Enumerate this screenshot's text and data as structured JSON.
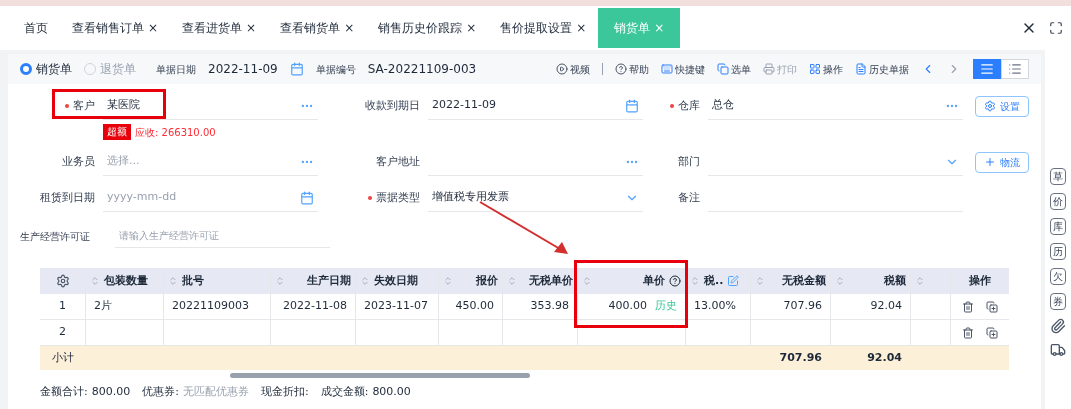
{
  "tabs": [
    {
      "label": "首页",
      "closable": false,
      "selected": false
    },
    {
      "label": "查看销售订单",
      "closable": true,
      "selected": false
    },
    {
      "label": "查看进货单",
      "closable": true,
      "selected": false
    },
    {
      "label": "查看销货单",
      "closable": true,
      "selected": false
    },
    {
      "label": "销售历史价跟踪",
      "closable": true,
      "selected": false
    },
    {
      "label": "售价提取设置",
      "closable": true,
      "selected": false
    },
    {
      "label": "销货单",
      "closable": true,
      "selected": true
    }
  ],
  "close_glyph": "×",
  "bill_types": [
    {
      "label": "销货单",
      "selected": true
    },
    {
      "label": "退货单",
      "selected": false
    }
  ],
  "bill_date": {
    "label": "单据日期",
    "value": "2022-11-09"
  },
  "bill_no": {
    "label": "单据编号",
    "value": "SA-20221109-003"
  },
  "toolbar": [
    {
      "kind": "video",
      "label": "视频",
      "disabled": false
    },
    {
      "kind": "help",
      "label": "帮助",
      "disabled": false
    },
    {
      "kind": "shortcut",
      "label": "快捷键",
      "disabled": false
    },
    {
      "kind": "pick",
      "label": "选单",
      "disabled": false
    },
    {
      "kind": "print",
      "label": "打印",
      "disabled": true
    },
    {
      "kind": "ops",
      "label": "操作",
      "disabled": false
    },
    {
      "kind": "history",
      "label": "历史单据",
      "disabled": false
    }
  ],
  "views": [
    {
      "kind": "list",
      "selected": true
    },
    {
      "kind": "detail",
      "selected": false
    }
  ],
  "form": [
    [
      {
        "label": "客户",
        "required": true,
        "value": "某医院",
        "kind": "more"
      },
      {
        "label": "收款到期日",
        "required": false,
        "value": "2022-11-09",
        "kind": "date"
      },
      {
        "label": "仓库",
        "required": true,
        "value": "总仓",
        "kind": "more"
      }
    ],
    [
      {
        "label": "业务员",
        "required": false,
        "placeholder": "选择...",
        "kind": "more"
      },
      {
        "label": "客户地址",
        "required": false,
        "kind": "more"
      },
      {
        "label": "部门",
        "required": false,
        "kind": "select"
      }
    ],
    [
      {
        "label": "租赁到日期",
        "required": false,
        "placeholder": "yyyy-mm-dd",
        "kind": "date"
      },
      {
        "label": "票据类型",
        "required": true,
        "value": "增值税专用发票",
        "kind": "select"
      },
      {
        "label": "备注",
        "required": false,
        "kind": "text"
      }
    ]
  ],
  "credit": {
    "badge": "超额",
    "text": "应收: 266310.00"
  },
  "side_buttons": [
    {
      "kind": "settings",
      "label": "设置"
    },
    {
      "kind": "add",
      "label": "物流"
    }
  ],
  "license": {
    "label": "生产经营许可证",
    "placeholder": "请输入生产经营许可证"
  },
  "table": {
    "columns": [
      {
        "label": "包装数量"
      },
      {
        "label": "批号"
      },
      {
        "label": "生产日期"
      },
      {
        "label": "失效日期"
      },
      {
        "label": "报价"
      },
      {
        "label": "无税单价"
      },
      {
        "label": "单价"
      },
      {
        "label": "税.."
      },
      {
        "label": "无税金额"
      },
      {
        "label": "税额"
      },
      {}
    ],
    "ops_label": "操作",
    "rows": [
      {
        "index": "1",
        "cells": [
          "2片",
          "20221109003",
          "2022-11-08",
          "2023-11-07",
          "450.00",
          "353.98",
          "400.00",
          "13.00%",
          "707.96",
          "92.04",
          ""
        ],
        "link": "历史"
      },
      {
        "index": "2",
        "cells": [
          "",
          "",
          "",
          "",
          "",
          "",
          "",
          "",
          "",
          "",
          ""
        ]
      }
    ],
    "subtotal": {
      "label": "小计",
      "cells": [
        "",
        "",
        "",
        "",
        "",
        "",
        "",
        "",
        "707.96",
        "92.04",
        ""
      ]
    }
  },
  "footer": [
    {
      "label": "金额合计:",
      "value": "800.00"
    },
    {
      "label": "优惠券:",
      "value": "无匹配优惠券"
    },
    {
      "label": "现金折扣:"
    },
    {
      "label": "成交金额:",
      "value": "800.00"
    }
  ],
  "rail": [
    {
      "kind": "char",
      "text": "草"
    },
    {
      "kind": "char",
      "text": "价"
    },
    {
      "kind": "char",
      "text": "库"
    },
    {
      "kind": "char",
      "text": "历"
    },
    {
      "kind": "char",
      "text": "欠"
    },
    {
      "kind": "char",
      "text": "券"
    },
    {
      "kind": "clip"
    },
    {
      "kind": "truck"
    }
  ]
}
